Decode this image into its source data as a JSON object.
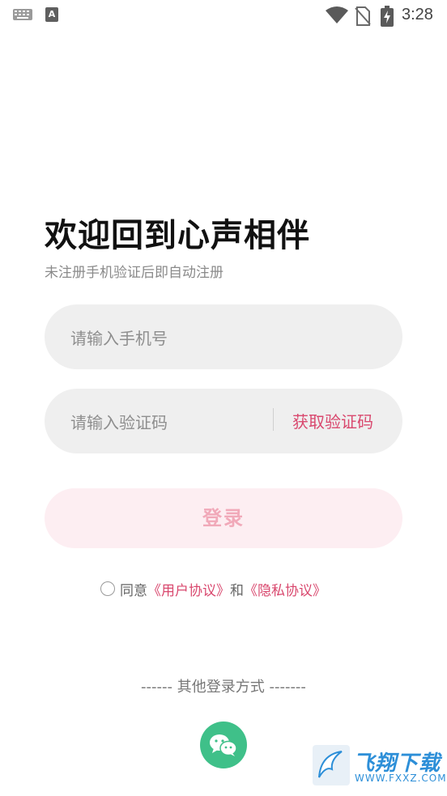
{
  "status_bar": {
    "a_label": "A",
    "time": "3:28"
  },
  "page": {
    "title": "欢迎回到心声相伴",
    "subtitle": "未注册手机验证后即自动注册"
  },
  "form": {
    "phone_placeholder": "请输入手机号",
    "code_placeholder": "请输入验证码",
    "get_code_label": "获取验证码",
    "login_label": "登录"
  },
  "agreement": {
    "prefix": "同意",
    "user_agreement": "《用户协议》",
    "and": "和",
    "privacy_agreement": "《隐私协议》"
  },
  "other_login": {
    "label": "------ 其他登录方式 -------",
    "options": [
      "wechat-icon"
    ]
  },
  "watermark": {
    "text": "飞翔下载",
    "url": "WWW.FXXZ.COM"
  },
  "colors": {
    "accent": "#d9486e",
    "login_bg": "#fdeef2",
    "login_text": "#f1a9b9",
    "wechat": "#3fc089",
    "field_bg": "#efefef"
  }
}
